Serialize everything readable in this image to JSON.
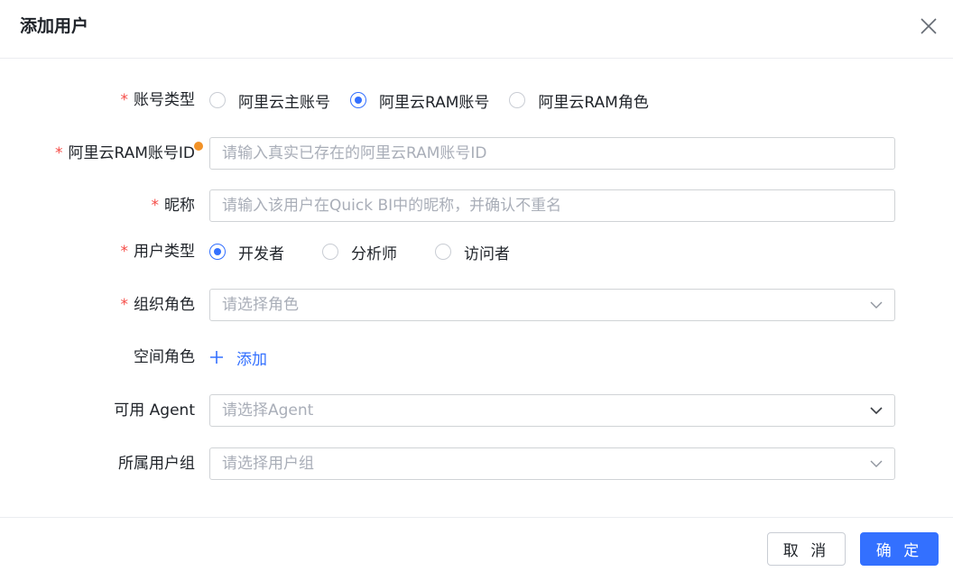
{
  "dialog": {
    "title": "添加用户"
  },
  "fields": {
    "account_type": {
      "label": "账号类型",
      "required": "*",
      "options": [
        "阿里云主账号",
        "阿里云RAM账号",
        "阿里云RAM角色"
      ],
      "selected": "阿里云RAM账号"
    },
    "ram_id": {
      "label": "阿里云RAM账号ID",
      "required": "*",
      "placeholder": "请输入真实已存在的阿里云RAM账号ID",
      "value": ""
    },
    "nickname": {
      "label": "昵称",
      "required": "*",
      "placeholder": "请输入该用户在Quick BI中的昵称，并确认不重名",
      "value": ""
    },
    "user_type": {
      "label": "用户类型",
      "required": "*",
      "options": [
        "开发者",
        "分析师",
        "访问者"
      ],
      "selected": "开发者"
    },
    "org_role": {
      "label": "组织角色",
      "required": "*",
      "placeholder": "请选择角色"
    },
    "space_role": {
      "label": "空间角色",
      "add_label": "添加"
    },
    "agent": {
      "label": "可用 Agent",
      "placeholder": "请选择Agent"
    },
    "user_group": {
      "label": "所属用户组",
      "placeholder": "请选择用户组"
    }
  },
  "footer": {
    "cancel_label": "取 消",
    "ok_label": "确 定"
  },
  "colors": {
    "accent": "#3370ff",
    "required": "#f54a45",
    "indicator": "#f29227"
  }
}
